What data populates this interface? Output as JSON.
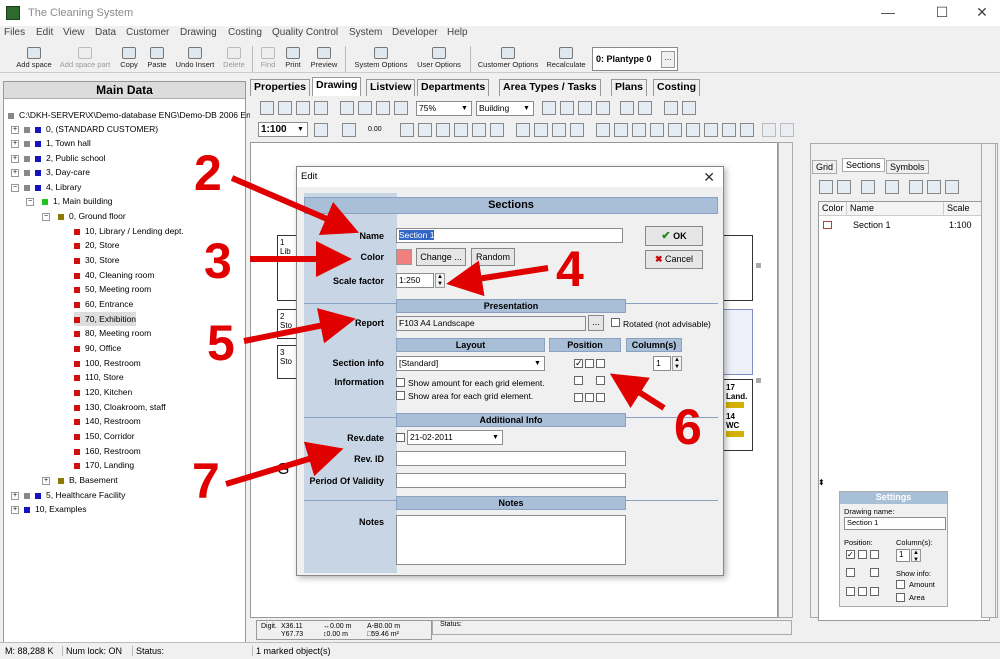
{
  "app": {
    "title": "The Cleaning System"
  },
  "window_controls": {
    "minimize": "—",
    "maximize": "☐",
    "close": "✕"
  },
  "menu": [
    "Files",
    "Edit",
    "View",
    "Data",
    "Customer",
    "Drawing",
    "Costing",
    "Quality Control",
    "System",
    "Developer",
    "Help"
  ],
  "toolbar": {
    "add_space": "Add space",
    "add_space_part": "Add space part",
    "copy": "Copy",
    "paste": "Paste",
    "undo_insert": "Undo Insert",
    "delete": "Delete",
    "find": "Find",
    "print": "Print",
    "preview": "Preview",
    "system_options": "System Options",
    "user_options": "User Options",
    "customer_options": "Customer Options",
    "recalculate": "Recalculate",
    "plantype": "0: Plantype 0",
    "plantype_dots": "..."
  },
  "main_data": {
    "title": "Main Data",
    "tree": [
      {
        "label": "C:\\DKH-SERVER\\X\\Demo-database ENG\\Demo-DB 2006 Engl"
      },
      {
        "label": "0, (STANDARD CUSTOMER)"
      },
      {
        "label": "1, Town hall"
      },
      {
        "label": "2, Public school"
      },
      {
        "label": "3, Day-care"
      },
      {
        "label": "4, Library"
      },
      {
        "label": "1, Main building"
      },
      {
        "label": "0, Ground floor"
      },
      {
        "label": "10, Library / Lending dept."
      },
      {
        "label": "20, Store"
      },
      {
        "label": "30, Store"
      },
      {
        "label": "40, Cleaning room"
      },
      {
        "label": "50, Meeting room"
      },
      {
        "label": "60, Entrance"
      },
      {
        "label": "70, Exhibition"
      },
      {
        "label": "80, Meeting room"
      },
      {
        "label": "90, Office"
      },
      {
        "label": "100, Restroom"
      },
      {
        "label": "110, Store"
      },
      {
        "label": "120, Kitchen"
      },
      {
        "label": "130, Cloakroom, staff"
      },
      {
        "label": "140, Restroom"
      },
      {
        "label": "150, Corridor"
      },
      {
        "label": "160, Restroom"
      },
      {
        "label": "170, Landing"
      },
      {
        "label": "B, Basement"
      },
      {
        "label": "5, Healthcare Facility"
      },
      {
        "label": "10, Examples"
      }
    ]
  },
  "tabs": [
    "Properties",
    "Drawing",
    "Listview",
    "Departments",
    "Area Types / Tasks",
    "Plans",
    "Costing"
  ],
  "drawing_toolbar": {
    "zoom": "75%",
    "layer": "Building",
    "scale": "1:100",
    "value": "0.00"
  },
  "canvas_labels": {
    "room1": "1",
    "room1b": "Lib",
    "room2": "2",
    "room2b": "Sto",
    "room3": "3",
    "room3b": "Sto",
    "room17": "17",
    "room17b": "Land.",
    "room14": "14",
    "room14b": "WC",
    "g_label": "G"
  },
  "coords": {
    "digit_label": "Digit.",
    "x": "X36.11",
    "y": "Y67.73",
    "dx": "↔0.00 m",
    "dy": "↕0.00 m",
    "ab": "A-B0.00 m",
    "area": "□59.46 m²",
    "status": "Status:"
  },
  "right_panel": {
    "tabs": [
      "Grid",
      "Sections",
      "Symbols"
    ],
    "columns": [
      "Color",
      "Name",
      "Scale"
    ],
    "rows": [
      {
        "name": "Section 1",
        "scale": "1:100"
      }
    ],
    "scroll_glyph": "⬍"
  },
  "settings": {
    "title": "Settings",
    "drawing_name_label": "Drawing name:",
    "drawing_name": "Section 1",
    "position_label": "Position:",
    "columns_label": "Column(s):",
    "columns_value": "1",
    "show_info_label": "Show info:",
    "amount_label": "Amount",
    "area_label": "Area"
  },
  "dialog": {
    "title": "Edit",
    "header": "Sections",
    "name_label": "Name",
    "name_value": "Section 1",
    "color_label": "Color",
    "change_button": "Change ...",
    "random_button": "Random",
    "scale_label": "Scale factor",
    "scale_value": "1:250",
    "ok": "OK",
    "cancel": "Cancel",
    "presentation_header": "Presentation",
    "report_label": "Report",
    "report_value": "F103 A4 Landscape",
    "report_dots": "...",
    "rotated_label": "Rotated (not advisable)",
    "layout_header": "Layout",
    "position_header": "Position",
    "columns_header": "Column(s)",
    "section_info_label": "Section info",
    "section_info_value": "[Standard]",
    "columns_value": "1",
    "information_label": "Information",
    "show_amount": "Show amount for each grid element.",
    "show_area": "Show area for each grid element.",
    "additional_header": "Additional Info",
    "revdate_label": "Rev.date",
    "revdate_value": "21-02-2011",
    "revid_label": "Rev. ID",
    "validity_label": "Period Of Validity",
    "notes_header": "Notes",
    "notes_label": "Notes"
  },
  "statusbar": {
    "memory": "M: 88,288 K",
    "numlock": "Num lock: ON",
    "status": "Status:",
    "marked": "1 marked object(s)"
  },
  "annotations": [
    "2",
    "3",
    "4",
    "5",
    "6",
    "7"
  ],
  "colors": {
    "annotation": "#e00000",
    "section_header": "#a9bed7",
    "dialog_left": "#c8d5e4",
    "section_color": "#f08080"
  }
}
